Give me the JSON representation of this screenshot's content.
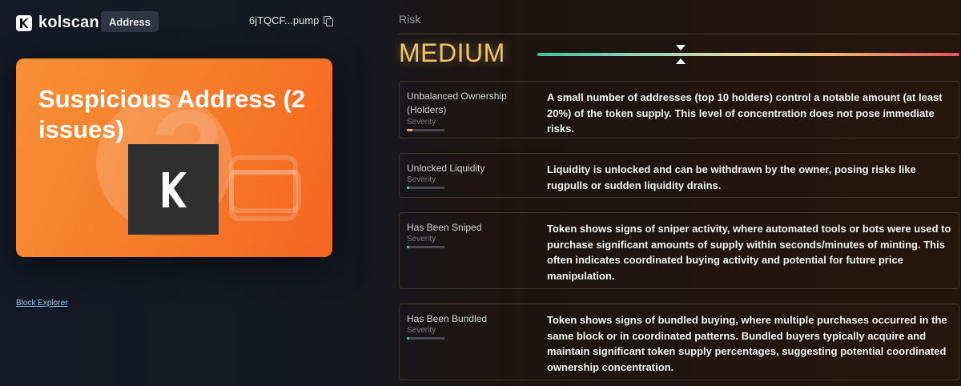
{
  "header": {
    "brand": "kolscan",
    "badge": "Address",
    "short_address": "6jTQCF...pump"
  },
  "card": {
    "title": "Suspicious Address (2 issues)"
  },
  "links": {
    "block_explorer": "Block Explorer"
  },
  "risk": {
    "label": "Risk",
    "level": "MEDIUM",
    "level_color": "#f2c468",
    "marker_position": 0.34
  },
  "issues": [
    {
      "name": "Unbalanced Ownership (Holders)",
      "severity_label": "Severity",
      "severity": 0.15,
      "severity_color": "#f2b14a",
      "description": "A small number of addresses (top 10 holders) control a notable amount (at least 20%) of the token supply. This level of concentration does not pose immediate risks."
    },
    {
      "name": "Unlocked Liquidity",
      "severity_label": "Severity",
      "severity": 0.06,
      "severity_color": "#3dcba6",
      "description": "Liquidity is unlocked and can be withdrawn by the owner, posing risks like rugpulls or sudden liquidity drains."
    },
    {
      "name": "Has Been Sniped",
      "severity_label": "Severity",
      "severity": 0.06,
      "severity_color": "#3dcba6",
      "description": "Token shows signs of sniper activity, where automated tools or bots were used to purchase significant amounts of supply within seconds/minutes of minting. This often indicates coordinated buying activity and potential for future price manipulation."
    },
    {
      "name": "Has Been Bundled",
      "severity_label": "Severity",
      "severity": 0.06,
      "severity_color": "#3dcba6",
      "description": "Token shows signs of bundled buying, where multiple purchases occurred in the same block or in coordinated patterns. Bundled buyers typically acquire and maintain significant token supply percentages, suggesting potential coordinated ownership concentration."
    }
  ]
}
